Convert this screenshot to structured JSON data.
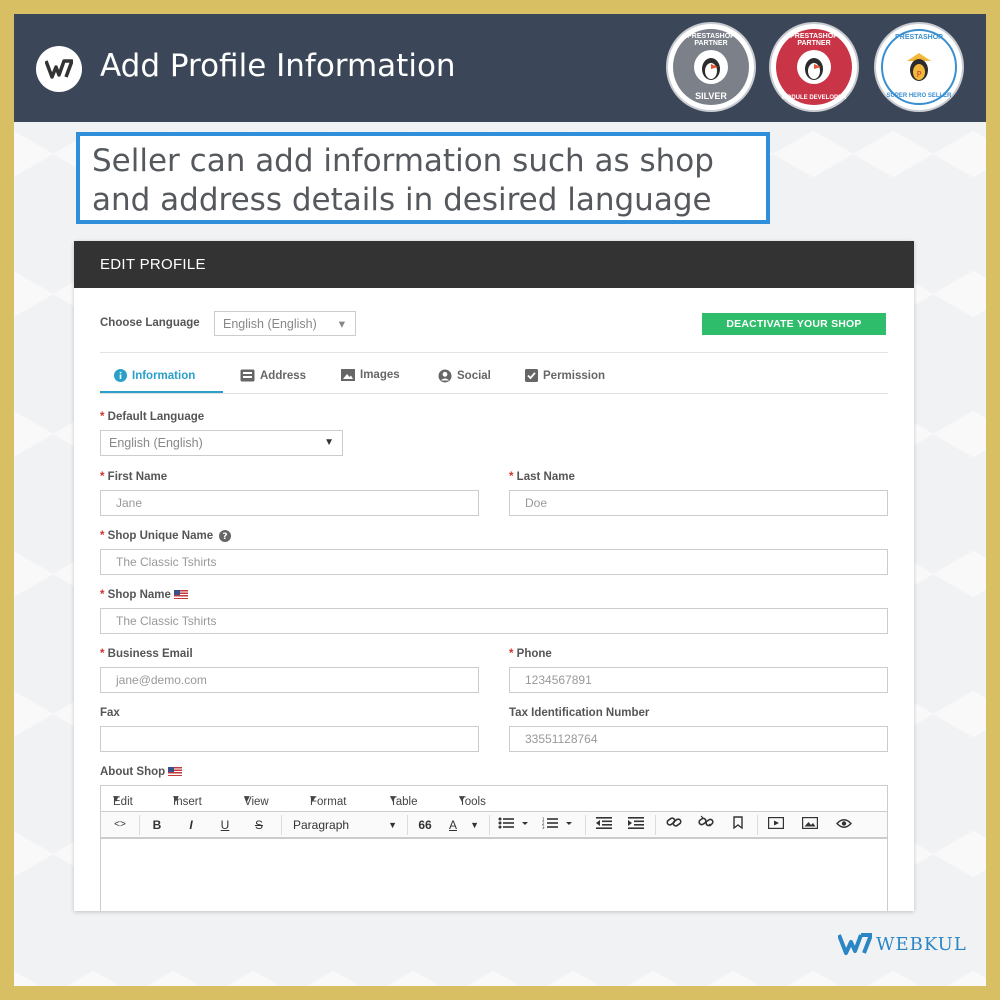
{
  "header": {
    "title": "Add Profile Information",
    "badges": [
      {
        "top": "PRESTASHOP PARTNER",
        "bottom": "SILVER",
        "color": "#7c8089"
      },
      {
        "top": "PRESTASHOP PARTNER",
        "bottom": "MODULE DEVELOPER",
        "color": "#c93546"
      },
      {
        "top": "PRESTASHOP",
        "bottom": "SUPER HERO SELLER",
        "color": "#3a8fd0"
      }
    ]
  },
  "callout": {
    "line1": "Seller can add information such as shop",
    "line2": "and address details in desired language"
  },
  "panel": {
    "title": "EDIT PROFILE",
    "choose_language_label": "Choose Language",
    "choose_language_value": "English (English)",
    "deactivate_button": "DEACTIVATE YOUR SHOP",
    "tabs": [
      {
        "label": "Information",
        "icon": "info-icon",
        "active": true
      },
      {
        "label": "Address",
        "icon": "address-card-icon",
        "active": false
      },
      {
        "label": "Images",
        "icon": "image-icon",
        "active": false
      },
      {
        "label": "Social",
        "icon": "user-circle-icon",
        "active": false
      },
      {
        "label": "Permission",
        "icon": "check-square-icon",
        "active": false
      }
    ],
    "fields": {
      "default_language": {
        "label": "Default Language",
        "value": "English (English)"
      },
      "first_name": {
        "label": "First Name",
        "value": "Jane"
      },
      "last_name": {
        "label": "Last Name",
        "value": "Doe"
      },
      "shop_unique_name": {
        "label": "Shop Unique Name",
        "value": "The Classic Tshirts"
      },
      "shop_name": {
        "label": "Shop Name",
        "value": "The Classic Tshirts"
      },
      "business_email": {
        "label": "Business Email",
        "value": "jane@demo.com"
      },
      "phone": {
        "label": "Phone",
        "value": "1234567891"
      },
      "fax": {
        "label": "Fax",
        "value": ""
      },
      "tax_id": {
        "label": "Tax Identification Number",
        "value": "33551128764"
      },
      "about_shop": {
        "label": "About Shop"
      }
    },
    "editor": {
      "menus": [
        "Edit",
        "Insert",
        "View",
        "Format",
        "Table",
        "Tools"
      ],
      "paragraph": "Paragraph",
      "buttons": {
        "code": "<>",
        "bold": "B",
        "italic": "I",
        "underline": "U",
        "strike": "S",
        "quote": "66",
        "font_color": "A"
      }
    }
  },
  "footer": {
    "brand": "WEBKUL"
  },
  "colors": {
    "accent": "#2aa0c9",
    "success": "#2ebd6b",
    "header": "#3b4758",
    "frame": "#d9bf63"
  }
}
